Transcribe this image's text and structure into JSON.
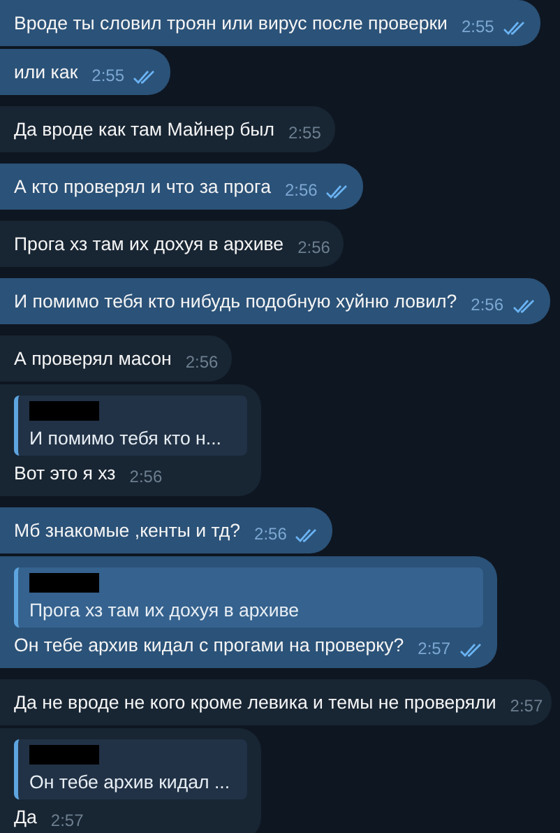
{
  "messages": [
    {
      "kind": "out",
      "text": "Вроде ты словил троян или вирус после проверки",
      "time": "2:55",
      "read": true
    },
    {
      "kind": "out",
      "text": "или как",
      "time": "2:55",
      "read": true
    },
    {
      "kind": "in",
      "text": "Да вроде как там Майнер был",
      "time": "2:55"
    },
    {
      "kind": "out",
      "text": "А кто проверял и что за прога",
      "time": "2:56",
      "read": true
    },
    {
      "kind": "in",
      "text": "Прога хз там их дохуя в архиве",
      "time": "2:56"
    },
    {
      "kind": "out",
      "text": "И помимо тебя кто нибудь подобную хуйню ловил?",
      "time": "2:56",
      "read": true
    },
    {
      "kind": "in",
      "text": "А проверял масон",
      "time": "2:56"
    },
    {
      "kind": "in",
      "reply": {
        "text": "И помимо тебя кто н..."
      },
      "text": "Вот это я хз",
      "time": "2:56"
    },
    {
      "kind": "out",
      "text": "Мб знакомые ,кенты и тд?",
      "time": "2:56",
      "read": true
    },
    {
      "kind": "out",
      "reply": {
        "text": "Прога хз там их дохуя в архиве"
      },
      "text": "Он тебе архив кидал с прогами на проверку?",
      "time": "2:57",
      "read": true
    },
    {
      "kind": "in",
      "text": "Да не вроде не кого кроме левика и темы не проверяли",
      "time": "2:57"
    },
    {
      "kind": "in",
      "reply": {
        "text": "Он тебе архив кидал ..."
      },
      "text": "Да",
      "time": "2:57"
    }
  ]
}
